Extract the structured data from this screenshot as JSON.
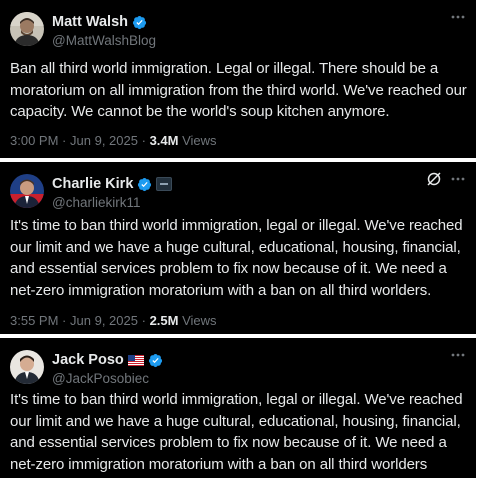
{
  "tweets": [
    {
      "display_name": "Matt Walsh",
      "handle": "@MattWalshBlog",
      "verified": true,
      "text": "Ban all third world immigration. Legal or illegal. There should be a moratorium on all immigration from the third world. We've reached our capacity. We cannot be the world's soup kitchen anymore.",
      "time": "3:00 PM",
      "separator": "·",
      "date": "Jun 9, 2025",
      "views_count": "3.4M",
      "views_label": "Views",
      "avatar_icon": "person-avatar-photo"
    },
    {
      "display_name": "Charlie Kirk",
      "handle": "@charliekirk11",
      "verified": true,
      "affiliate_badge": true,
      "text": "It's time to ban third world immigration, legal or illegal. We've reached our limit and we have a huge cultural, educational, housing, financial, and essential services problem to fix now because of it. We need a net-zero immigration moratorium with a ban on all third worlders.",
      "time": "3:55 PM",
      "separator": "·",
      "date": "Jun 9, 2025",
      "views_count": "2.5M",
      "views_label": "Views",
      "avatar_icon": "person-avatar-photo"
    },
    {
      "display_name": "Jack Poso",
      "flag_icon": "us-flag-icon",
      "handle": "@JackPosobiec",
      "verified": true,
      "text": "It's time to ban third world immigration, legal or illegal. We've reached our limit and we have a huge cultural, educational, housing, financial, and essential services problem to fix now because of it. We need a net-zero immigration moratorium with a ban on all third worlders",
      "avatar_icon": "person-avatar-photo"
    }
  ],
  "colors": {
    "background": "#000000",
    "text": "#e7e9ea",
    "muted": "#71767b",
    "verified": "#1d9bf0",
    "page": "#ffffff"
  }
}
